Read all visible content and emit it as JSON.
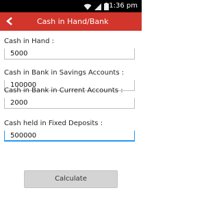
{
  "status_bar": {
    "time": "11:36 pm",
    "icons": [
      "wifi-icon",
      "signal-icon",
      "battery-icon"
    ]
  },
  "action_bar": {
    "title": "Cash in Hand/Bank",
    "accent_color": "#d2352c"
  },
  "form": {
    "fields": [
      {
        "label": "Cash in Hand :",
        "value": "5000"
      },
      {
        "label": "Cash in Bank in Savings Accounts :",
        "value": "100000"
      },
      {
        "label": "Cash in Bank in Current Accounts :",
        "value": "2000"
      },
      {
        "label": "Cash held in Fixed Deposits :",
        "value": "500000"
      }
    ],
    "calculate_label": "Calculate"
  }
}
